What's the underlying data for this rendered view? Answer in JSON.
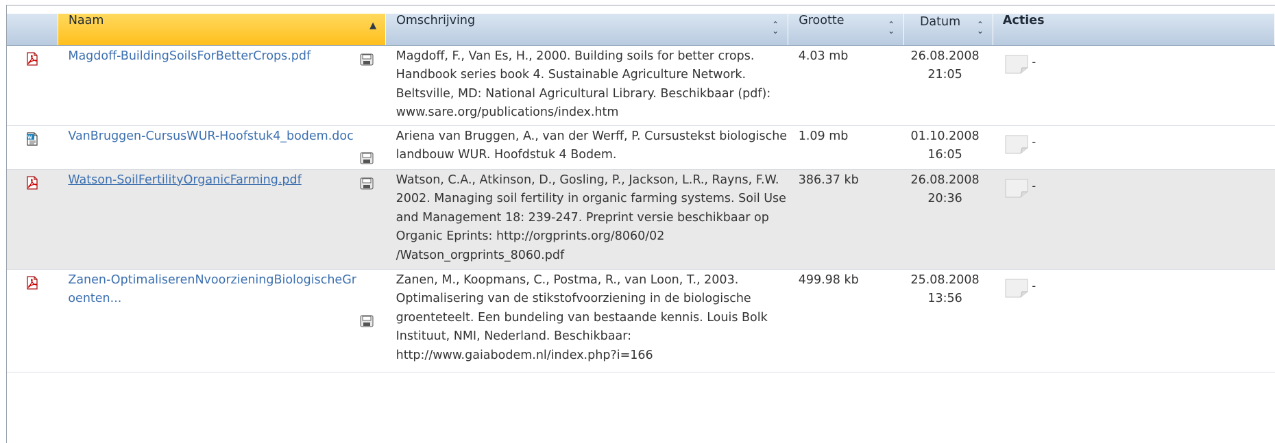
{
  "table": {
    "columns": {
      "icon": "",
      "name": "Naam",
      "description": "Omschrijving",
      "size": "Grootte",
      "date": "Datum",
      "actions": "Acties"
    },
    "sort": {
      "column": "Naam",
      "direction": "ascending"
    },
    "rows": [
      {
        "type": "pdf",
        "name": "Magdoff-BuildingSoilsForBetterCrops.pdf",
        "description": "Magdoff, F., Van Es, H., 2000. Building soils for better crops. Handbook series book 4. Sustainable Agriculture Network. Beltsville, MD: National Agricultural Library. Beschikbaar (pdf): www.sare.org/publications/index.htm",
        "size": "4.03 mb",
        "date": "26.08.2008",
        "time": "21:05",
        "action_dash": "-"
      },
      {
        "type": "doc",
        "name": "VanBruggen-CursusWUR-Hoofstuk4_bodem.doc",
        "description": "Ariena van Bruggen, A., van der Werff, P. Cursustekst biologische landbouw WUR. Hoofdstuk 4 Bodem.",
        "size": "1.09 mb",
        "date": "01.10.2008",
        "time": "16:05",
        "action_dash": "-"
      },
      {
        "type": "pdf",
        "name": "Watson-SoilFertilityOrganicFarming.pdf",
        "description": "Watson, C.A., Atkinson, D., Gosling, P., Jackson, L.R., Rayns, F.W. 2002. Managing soil fertility in organic farming systems. Soil Use and Management 18: 239-247. Preprint versie beschikbaar op Organic Eprints: http://orgprints.org/8060/02 /Watson_orgprints_8060.pdf",
        "size": "386.37 kb",
        "date": "26.08.2008",
        "time": "20:36",
        "action_dash": "-"
      },
      {
        "type": "pdf",
        "name": "Zanen-OptimaliserenNvoorzieningBiologischeGroenten...",
        "description": "Zanen, M., Koopmans, C., Postma, R., van Loon, T., 2003. Optimalisering van de stikstofvoorziening in de biologische groenteteelt. Een bundeling van bestaande kennis. Louis Bolk Instituut, NMI, Nederland. Beschikbaar: http://www.gaiabodem.nl/index.php?i=166",
        "size": "499.98 kb",
        "date": "25.08.2008",
        "time": "13:56",
        "action_dash": "-"
      }
    ]
  }
}
